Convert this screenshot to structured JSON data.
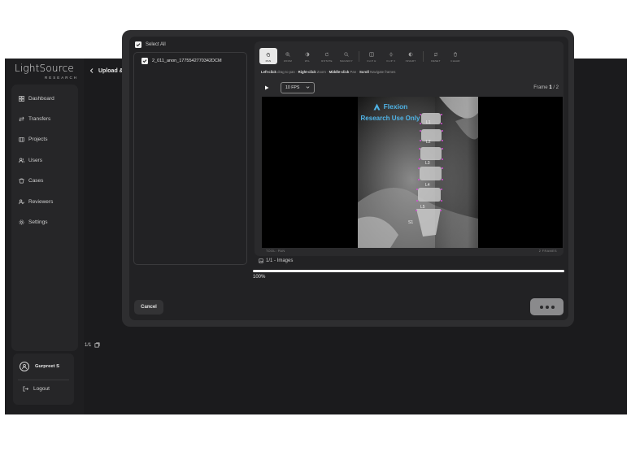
{
  "brand": {
    "name": "LightSource",
    "sub": "RESEARCH"
  },
  "sidebar": {
    "items": [
      {
        "label": "Dashboard",
        "icon": "grid-icon"
      },
      {
        "label": "Transfers",
        "icon": "arrows-icon"
      },
      {
        "label": "Projects",
        "icon": "folder-icon"
      },
      {
        "label": "Users",
        "icon": "users-icon"
      },
      {
        "label": "Cases",
        "icon": "cases-icon"
      },
      {
        "label": "Reviewers",
        "icon": "reviewer-icon"
      },
      {
        "label": "Settings",
        "icon": "gear-icon"
      }
    ]
  },
  "user": {
    "name": "Gurpreet S",
    "logout_label": "Logout"
  },
  "header": {
    "title": "Upload & Transfer"
  },
  "select_all_label": "Select All",
  "files": [
    {
      "name": "2_011_anon_1775542770342DCM",
      "checked": true
    }
  ],
  "viewer": {
    "tools": [
      {
        "label": "PAN",
        "active": true
      },
      {
        "label": "ZOOM"
      },
      {
        "label": "W/L"
      },
      {
        "label": "ROTATE"
      },
      {
        "label": "MAGNIFY"
      },
      {
        "label": "FLIP H"
      },
      {
        "label": "FLIP V"
      },
      {
        "label": "INVERT"
      },
      {
        "label": "RESET"
      },
      {
        "label": "CLEAR"
      }
    ],
    "hint": {
      "left_click": "Left-click",
      "left_action": "drag to pan ·",
      "right_click": "Right-click",
      "right_action": "Zoom ·",
      "middle_click": "Middle-click",
      "middle_action": "Pan ·",
      "scroll": "Scroll",
      "scroll_action": "Navigate frames"
    },
    "fps": "10 FPS",
    "frame_prefix": "Frame",
    "frame_current": "1",
    "frame_total": "/ 2",
    "watermark_brand": "Flexion",
    "watermark_text": "Research Use Only",
    "vertebrae": [
      "L1",
      "L2",
      "L3",
      "L4",
      "L5",
      "S1"
    ],
    "tool_status": "TOOL: PAN",
    "frames_status": "2 FRAMES"
  },
  "images_label": "1/1 - Images",
  "progress": {
    "percent": 100,
    "label": "100%"
  },
  "cancel_label": "Cancel",
  "pager_label": "1/1"
}
